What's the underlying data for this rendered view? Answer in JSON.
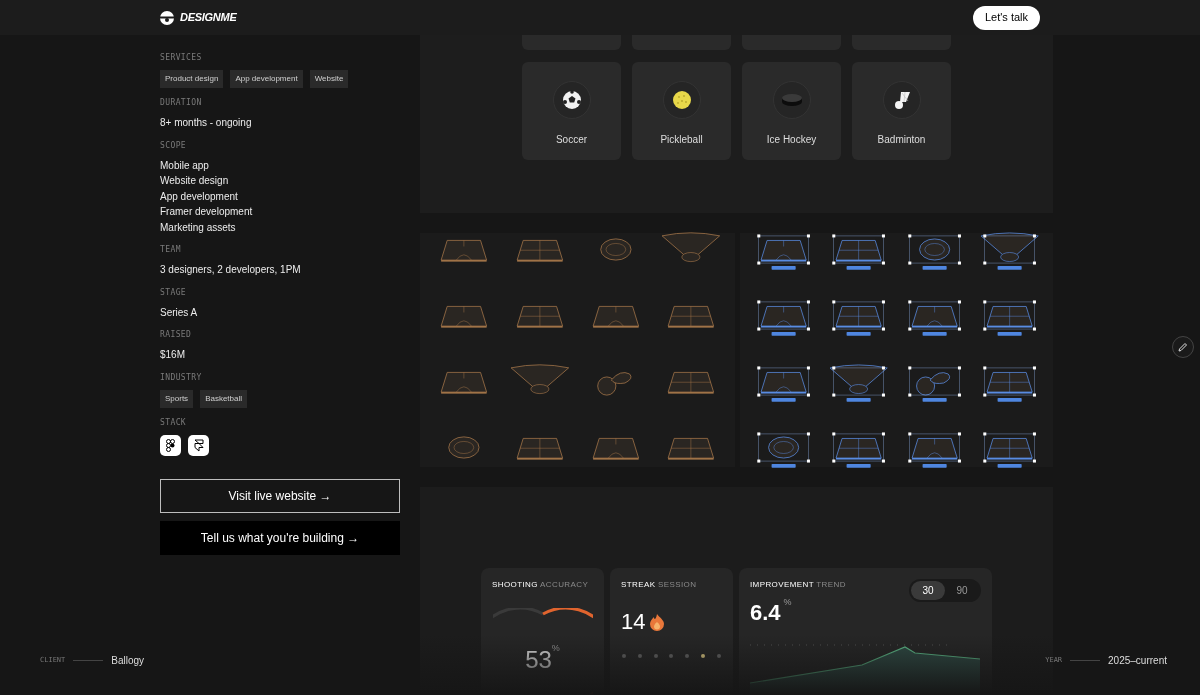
{
  "header": {
    "logo": "DESIGNME",
    "cta": "Let's talk"
  },
  "details": [
    {
      "kind": "tags",
      "label": "SERVICES",
      "items": [
        "Product design",
        "App development",
        "Website"
      ]
    },
    {
      "kind": "text",
      "label": "DURATION",
      "items": [
        "8+ months - ongoing"
      ]
    },
    {
      "kind": "text",
      "label": "SCOPE",
      "items": [
        "Mobile app",
        "Website design",
        "App development",
        "Framer development",
        "Marketing assets"
      ]
    },
    {
      "kind": "text",
      "label": "TEAM",
      "items": [
        "3 designers, 2 developers, 1PM"
      ]
    },
    {
      "kind": "text",
      "label": "STAGE",
      "items": [
        "Series A"
      ]
    },
    {
      "kind": "text",
      "label": "RAISED",
      "items": [
        "$16M"
      ]
    },
    {
      "kind": "tags",
      "label": "INDUSTRY",
      "items": [
        "Sports",
        "Basketball"
      ]
    },
    {
      "kind": "stack",
      "label": "STACK"
    }
  ],
  "buttons": [
    {
      "kind": "outline",
      "label": "Visit live website →"
    },
    {
      "kind": "solid",
      "label": "Tell us what you're building →"
    }
  ],
  "sports": [
    {
      "kind": "soccer",
      "name": "Soccer"
    },
    {
      "kind": "pickleball",
      "name": "Pickleball"
    },
    {
      "kind": "puck",
      "name": "Ice Hockey"
    },
    {
      "kind": "shuttlecock",
      "name": "Badminton"
    }
  ],
  "stats": {
    "accuracy": {
      "title": "SHOOTING",
      "subtitle": "ACCURACY",
      "value": "53",
      "unit": "%"
    },
    "streak": {
      "title": "STREAK",
      "subtitle": "SESSION",
      "value": "14",
      "dots": [
        {
          "on": false
        },
        {
          "on": false
        },
        {
          "on": false
        },
        {
          "on": false
        },
        {
          "on": false
        },
        {
          "on": true
        },
        {
          "on": false
        }
      ]
    },
    "trend": {
      "title": "IMPROVEMENT",
      "subtitle": "TREND",
      "value": "6.4",
      "unit": "%",
      "ranges": [
        {
          "label": "30",
          "selected": true
        },
        {
          "label": "90",
          "selected": false
        }
      ]
    }
  },
  "footer": {
    "client_label": "CLIENT",
    "client": "Ballogy",
    "year_label": "YEAR",
    "year": "2025–current"
  }
}
